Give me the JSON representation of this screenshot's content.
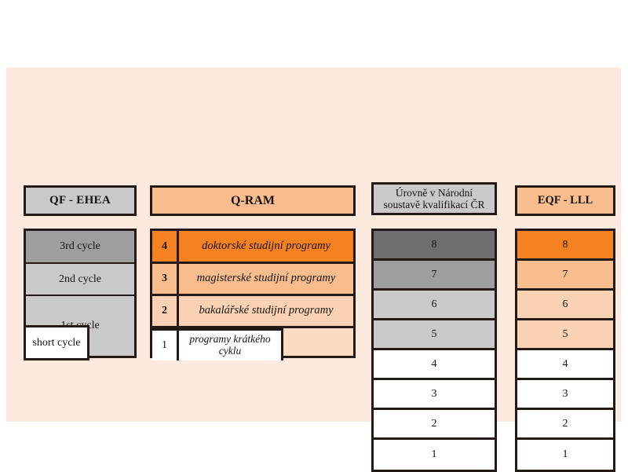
{
  "theme": {
    "page_background": "#ffffff",
    "panel_background": "#fdeade",
    "border": "#231a17",
    "gray_dark": "#6e6e6e",
    "gray_mid": "#9e9e9e",
    "gray_light": "#c9c9c9",
    "orange_strong": "#f58220",
    "orange_mid": "#f7bd8e",
    "orange_light": "#fbd3b4",
    "orange_pale": "#fbdcc2",
    "white": "#ffffff"
  },
  "columns": {
    "qf_ehea": {
      "header": "QF - EHEA",
      "header_color": "#c9c9c9",
      "rows": [
        {
          "label": "3rd cycle",
          "color": "#9e9e9e"
        },
        {
          "label": "2nd cycle",
          "color": "#c9c9c9"
        },
        {
          "label": "1st cycle",
          "color": "#c9c9c9"
        }
      ],
      "overlay": {
        "label": "short cycle",
        "color": "#ffffff"
      }
    },
    "qram": {
      "header": "Q-RAM",
      "header_color": "#f7bd8e",
      "rows": [
        {
          "level": "4",
          "label": "doktorské studijní programy",
          "color": "#f58220"
        },
        {
          "level": "3",
          "label": "magisterské studijní programy",
          "color": "#f7bd8e"
        },
        {
          "level": "2",
          "label": "bakalářské studijní programy",
          "color": "#fbd3b4"
        },
        {
          "level": "1",
          "label": "programy krátkého cyklu",
          "color": "#ffffff"
        }
      ]
    },
    "nsk": {
      "header_line1": "Úrovně v Národní",
      "header_line2": "soustavě kvalifikací ČR",
      "header_color": "#c9c9c9",
      "rows": [
        {
          "level": "8",
          "color": "#6e6e6e"
        },
        {
          "level": "7",
          "color": "#9e9e9e"
        },
        {
          "level": "6",
          "color": "#c9c9c9"
        },
        {
          "level": "5",
          "color": "#c9c9c9"
        },
        {
          "level": "4",
          "color": "#ffffff"
        },
        {
          "level": "3",
          "color": "#ffffff"
        },
        {
          "level": "2",
          "color": "#ffffff"
        },
        {
          "level": "1",
          "color": "#ffffff"
        }
      ]
    },
    "eqf_lll": {
      "header": "EQF - LLL",
      "header_color": "#f7bd8e",
      "rows": [
        {
          "level": "8",
          "color": "#f58220"
        },
        {
          "level": "7",
          "color": "#f7bd8e"
        },
        {
          "level": "6",
          "color": "#fbd3b4"
        },
        {
          "level": "5",
          "color": "#fbd3b4"
        },
        {
          "level": "4",
          "color": "#ffffff"
        },
        {
          "level": "3",
          "color": "#ffffff"
        },
        {
          "level": "2",
          "color": "#ffffff"
        },
        {
          "level": "1",
          "color": "#ffffff"
        }
      ]
    }
  }
}
